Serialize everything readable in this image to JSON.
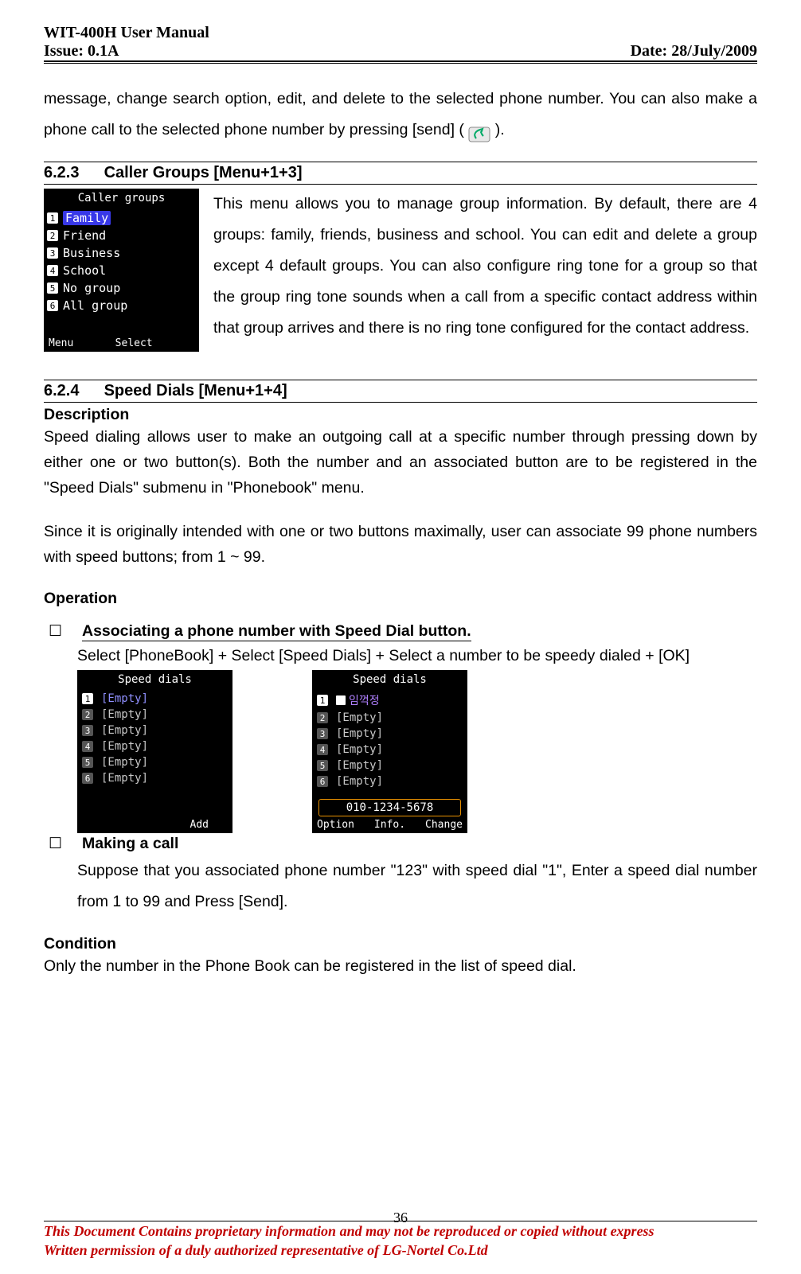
{
  "header": {
    "left1": "WIT-400H User Manual",
    "left2": "Issue: 0.1A",
    "right": "Date: 28/July/2009"
  },
  "intro": {
    "p1a": "message, change search option, edit, and delete to the selected phone number. You can also make a phone call to the selected phone number by pressing [send] ( ",
    "p1b": " )."
  },
  "s623": {
    "num": "6.2.3",
    "title": "Caller Groups [Menu+1+3]",
    "screenshot": {
      "title": "Caller groups",
      "items": [
        {
          "n": "1",
          "label": "Family",
          "sel": true
        },
        {
          "n": "2",
          "label": "Friend"
        },
        {
          "n": "3",
          "label": "Business"
        },
        {
          "n": "4",
          "label": "School"
        },
        {
          "n": "5",
          "label": "No group"
        },
        {
          "n": "6",
          "label": "All group"
        }
      ],
      "softLeft": "Menu",
      "softCenter": "Select"
    },
    "text": "This menu allows you to manage group information. By default, there are 4 groups: family, friends, business and school. You can edit and delete a group except 4 default groups. You can also configure ring tone for a group so that the group ring tone sounds when a call from a specific contact address within that group arrives and there is no ring tone configured for the contact address."
  },
  "s624": {
    "num": "6.2.4",
    "title": "Speed Dials [Menu+1+4]",
    "descTitle": "Description",
    "desc1": "Speed dialing allows user to make an outgoing call at a specific number through pressing down by either one or two button(s). Both the number and an associated button are to be registered in the \"Speed Dials\" submenu in \"Phonebook\" menu.",
    "desc2": "Since it is originally intended with one or two buttons maximally, user can associate 99 phone numbers with speed buttons; from 1 ~ 99.",
    "opTitle": "Operation",
    "op1": {
      "label": "Associating a phone number with Speed Dial button.",
      "sub": "Select [PhoneBook] + Select [Speed Dials] + Select a number to be speedy dialed + [OK]",
      "scrA": {
        "title": "Speed dials",
        "rows": [
          {
            "n": "1",
            "lbl": "[Empty]",
            "sel": true,
            "light": true
          },
          {
            "n": "2",
            "lbl": "[Empty]"
          },
          {
            "n": "3",
            "lbl": "[Empty]"
          },
          {
            "n": "4",
            "lbl": "[Empty]"
          },
          {
            "n": "5",
            "lbl": "[Empty]"
          },
          {
            "n": "6",
            "lbl": "[Empty]"
          }
        ],
        "softRight": "Add"
      },
      "scrB": {
        "title": "Speed dials",
        "rows": [
          {
            "n": "1",
            "lbl": "임꺽정",
            "sel": true,
            "card": true,
            "korean": true
          },
          {
            "n": "2",
            "lbl": "[Empty]"
          },
          {
            "n": "3",
            "lbl": "[Empty]"
          },
          {
            "n": "4",
            "lbl": "[Empty]"
          },
          {
            "n": "5",
            "lbl": "[Empty]"
          },
          {
            "n": "6",
            "lbl": "[Empty]"
          }
        ],
        "phone": "010-1234-5678",
        "softLeft": "Option",
        "softCenter": "Info.",
        "softRight": "Change"
      }
    },
    "op2": {
      "label": "Making a call",
      "sub": "Suppose that you associated phone number \"123\" with speed dial \"1\", Enter a speed dial number from 1 to 99 and Press [Send]."
    },
    "condTitle": "Condition",
    "condText": "Only the number in the Phone Book can be registered in the list of speed dial."
  },
  "pageNum": "36",
  "footer": {
    "l1": "This Document Contains proprietary information and may not be reproduced or copied without express",
    "l2": "Written permission of a duly authorized representative of LG-Nortel Co.Ltd"
  }
}
